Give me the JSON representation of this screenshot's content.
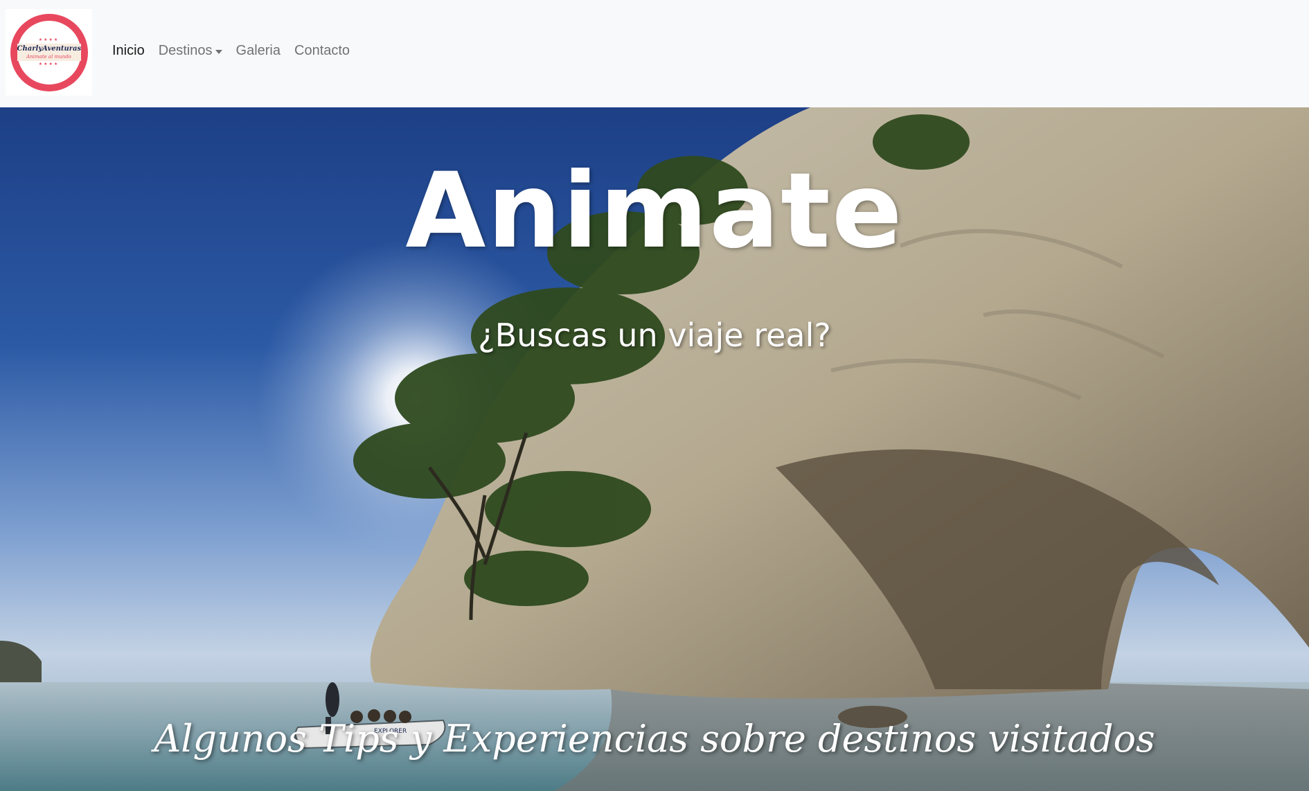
{
  "brand": {
    "name": "CharlyAventuras",
    "tagline": "Animate al mundo",
    "colors": {
      "ring": "#e8485e",
      "text": "#1f2a55",
      "band": "#f7ece0"
    }
  },
  "nav": {
    "items": [
      {
        "label": "Inicio",
        "active": true
      },
      {
        "label": "Destinos",
        "dropdown": true
      },
      {
        "label": "Galeria"
      },
      {
        "label": "Contacto"
      }
    ]
  },
  "hero": {
    "title": "Animate",
    "subtitle": "¿Buscas un viaje real?",
    "tagline": "Algunos Tips y Experiencias sobre destinos visitados",
    "boat_label": "EXPLORER",
    "colors": {
      "sky_top": "#1d3f86",
      "rock": "#b7ad98",
      "sea": "#88a6b4"
    }
  }
}
